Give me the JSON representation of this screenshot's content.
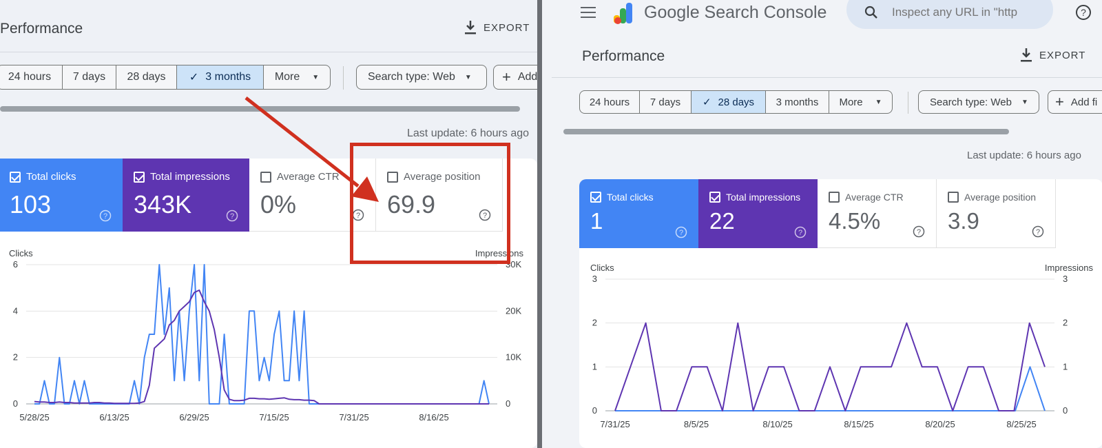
{
  "left": {
    "title": "Performance",
    "export_label": "EXPORT",
    "date_options": [
      "24 hours",
      "7 days",
      "28 days",
      "3 months",
      "More"
    ],
    "active_date": "3 months",
    "search_type_label": "Search type: Web",
    "add_filter_label": "Add",
    "last_update": "Last update: 6 hours ago",
    "metrics": [
      {
        "label": "Total clicks",
        "value": "103",
        "checked": true,
        "color": "#4285f4"
      },
      {
        "label": "Total impressions",
        "value": "343K",
        "checked": true,
        "color": "#5e35b1"
      },
      {
        "label": "Average CTR",
        "value": "0%",
        "checked": false
      },
      {
        "label": "Average position",
        "value": "69.9",
        "checked": false
      }
    ]
  },
  "right": {
    "brand": "Google Search Console",
    "search_placeholder": "Inspect any URL in \"http",
    "title": "Performance",
    "export_label": "EXPORT",
    "date_options": [
      "24 hours",
      "7 days",
      "28 days",
      "3 months",
      "More"
    ],
    "active_date": "28 days",
    "search_type_label": "Search type: Web",
    "add_filter_label": "Add fi",
    "last_update": "Last update: 6 hours ago",
    "metrics": [
      {
        "label": "Total clicks",
        "value": "1",
        "checked": true,
        "color": "#4285f4"
      },
      {
        "label": "Total impressions",
        "value": "22",
        "checked": true,
        "color": "#5e35b1"
      },
      {
        "label": "Average CTR",
        "value": "4.5%",
        "checked": false
      },
      {
        "label": "Average position",
        "value": "3.9",
        "checked": false
      }
    ]
  },
  "chart_data": [
    {
      "type": "line",
      "y_left_label": "Clicks",
      "y_right_label": "Impressions",
      "y_left_ticks": [
        "0",
        "2",
        "4",
        "6"
      ],
      "y_right_ticks": [
        "0",
        "10K",
        "20K",
        "30K"
      ],
      "ylim_left": [
        0,
        6
      ],
      "ylim_right": [
        0,
        30000
      ],
      "x_ticks": [
        "5/28/25",
        "6/13/25",
        "6/29/25",
        "7/15/25",
        "7/31/25",
        "8/16/25"
      ],
      "series": [
        {
          "name": "Total clicks",
          "axis": "left",
          "color": "#4285f4",
          "values": [
            0,
            0,
            1,
            0,
            0,
            2,
            0,
            0,
            1,
            0,
            1,
            0,
            0,
            0,
            0,
            0,
            0,
            0,
            0,
            0,
            1,
            0,
            2,
            3,
            3,
            6,
            3,
            5,
            1,
            4,
            1,
            4,
            6,
            1,
            6,
            0,
            0,
            0,
            3,
            0,
            0,
            0,
            0,
            4,
            4,
            1,
            2,
            1,
            3,
            4,
            1,
            1,
            4,
            1,
            4,
            0,
            0,
            0,
            0,
            0,
            0,
            0,
            0,
            0,
            0,
            0,
            0,
            0,
            0,
            0,
            0,
            0,
            0,
            0,
            0,
            0,
            0,
            0,
            0,
            0,
            0,
            0,
            0,
            0,
            0,
            0,
            0,
            0,
            0,
            0,
            1,
            0
          ]
        },
        {
          "name": "Total impressions",
          "axis": "right",
          "color": "#5e35b1",
          "values": [
            500,
            400,
            400,
            300,
            300,
            400,
            300,
            300,
            200,
            200,
            200,
            200,
            300,
            300,
            200,
            200,
            100,
            100,
            100,
            100,
            100,
            200,
            500,
            4000,
            12000,
            13000,
            14000,
            17000,
            18000,
            20000,
            21000,
            22000,
            24000,
            24500,
            22000,
            20000,
            16000,
            10000,
            3000,
            1000,
            700,
            700,
            800,
            1200,
            1200,
            1100,
            1100,
            1000,
            1100,
            1200,
            1300,
            1000,
            900,
            900,
            800,
            800,
            700,
            0,
            0,
            0,
            0,
            0,
            0,
            0,
            0,
            0,
            0,
            0,
            0,
            0,
            0,
            0,
            0,
            0,
            0,
            0,
            0,
            0,
            0,
            0,
            0,
            0,
            0,
            0,
            0,
            0,
            0,
            0,
            0,
            0,
            0,
            0
          ]
        }
      ]
    },
    {
      "type": "line",
      "y_left_label": "Clicks",
      "y_right_label": "Impressions",
      "y_left_ticks": [
        "0",
        "1",
        "2",
        "3"
      ],
      "y_right_ticks": [
        "0",
        "1",
        "2",
        "3"
      ],
      "ylim_left": [
        0,
        3
      ],
      "ylim_right": [
        0,
        3
      ],
      "x_ticks": [
        "7/31/25",
        "8/5/25",
        "8/10/25",
        "8/15/25",
        "8/20/25",
        "8/25/25"
      ],
      "series": [
        {
          "name": "Total clicks",
          "axis": "left",
          "color": "#4285f4",
          "values": [
            0,
            0,
            0,
            0,
            0,
            0,
            0,
            0,
            0,
            0,
            0,
            0,
            0,
            0,
            0,
            0,
            0,
            0,
            0,
            0,
            0,
            0,
            0,
            0,
            0,
            0,
            0,
            0,
            1,
            0
          ]
        },
        {
          "name": "Total impressions",
          "axis": "right",
          "color": "#5e35b1",
          "values": [
            0,
            1,
            2,
            0,
            0,
            1,
            1,
            0,
            2,
            0,
            1,
            1,
            0,
            0,
            1,
            0,
            1,
            1,
            1,
            2,
            1,
            1,
            0,
            1,
            1,
            0,
            0,
            2,
            1
          ]
        }
      ]
    }
  ]
}
